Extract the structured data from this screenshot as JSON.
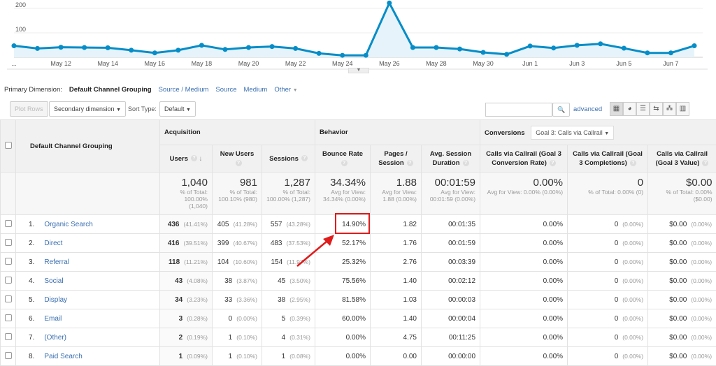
{
  "chart_data": {
    "type": "area",
    "x": [
      "May 10",
      "May 11",
      "May 12",
      "May 13",
      "May 14",
      "May 15",
      "May 16",
      "May 17",
      "May 18",
      "May 19",
      "May 20",
      "May 21",
      "May 22",
      "May 23",
      "May 24",
      "May 25",
      "May 26",
      "May 27",
      "May 28",
      "May 29",
      "May 30",
      "May 31",
      "Jun 1",
      "Jun 2",
      "Jun 3",
      "Jun 4",
      "Jun 5",
      "Jun 6",
      "Jun 7",
      "Jun 8"
    ],
    "values": [
      47,
      36,
      41,
      40,
      39,
      29,
      18,
      29,
      49,
      32,
      40,
      44,
      36,
      16,
      8,
      8,
      222,
      40,
      40,
      34,
      20,
      12,
      46,
      38,
      49,
      55,
      37,
      18,
      18,
      47
    ],
    "x_tick_labels": [
      "...",
      "May 12",
      "May 14",
      "May 16",
      "May 18",
      "May 20",
      "May 22",
      "May 24",
      "May 26",
      "May 28",
      "May 30",
      "Jun 1",
      "Jun 3",
      "Jun 5",
      "Jun 7"
    ],
    "y_tick_labels": [
      "100",
      "200"
    ],
    "ylim": [
      0,
      235
    ],
    "grid": true,
    "color": "#058dc7"
  },
  "primary_dimension": {
    "label": "Primary Dimension:",
    "active": "Default Channel Grouping",
    "options": [
      "Source / Medium",
      "Source",
      "Medium",
      "Other"
    ]
  },
  "toolbar": {
    "plot_rows": "Plot Rows",
    "secondary_dimension": "Secondary dimension",
    "sort_type_label": "Sort Type:",
    "sort_type": "Default",
    "search_placeholder": "",
    "advanced": "advanced"
  },
  "table": {
    "dimension_header": "Default Channel Grouping",
    "groups": {
      "acquisition": "Acquisition",
      "behavior": "Behavior",
      "conversions": "Conversions",
      "goal_select": "Goal 3: Calls via Callrail"
    },
    "columns": [
      "Users",
      "New Users",
      "Sessions",
      "Bounce Rate",
      "Pages / Session",
      "Avg. Session Duration",
      "Calls via Callrail (Goal 3 Conversion Rate)",
      "Calls via Callrail (Goal 3 Completions)",
      "Calls via Callrail (Goal 3 Value)"
    ],
    "totals": [
      {
        "value": "1,040",
        "sub": "% of Total: 100.00% (1,040)"
      },
      {
        "value": "981",
        "sub": "% of Total: 100.10% (980)"
      },
      {
        "value": "1,287",
        "sub": "% of Total: 100.00% (1,287)"
      },
      {
        "value": "34.34%",
        "sub": "Avg for View: 34.34% (0.00%)"
      },
      {
        "value": "1.88",
        "sub": "Avg for View: 1.88 (0.00%)"
      },
      {
        "value": "00:01:59",
        "sub": "Avg for View: 00:01:59 (0.00%)"
      },
      {
        "value": "0.00%",
        "sub": "Avg for View: 0.00% (0.00%)"
      },
      {
        "value": "0",
        "sub": "% of Total: 0.00% (0)"
      },
      {
        "value": "$0.00",
        "sub": "% of Total: 0.00% ($0.00)"
      }
    ],
    "rows": [
      {
        "n": "1.",
        "name": "Organic Search",
        "users": "436",
        "users_pc": "(41.41%)",
        "new": "405",
        "new_pc": "(41.28%)",
        "sess": "557",
        "sess_pc": "(43.28%)",
        "bounce": "14.90%",
        "pps": "1.82",
        "dur": "00:01:35",
        "cr": "0.00%",
        "comp": "0",
        "comp_pc": "(0.00%)",
        "val": "$0.00",
        "val_pc": "(0.00%)"
      },
      {
        "n": "2.",
        "name": "Direct",
        "users": "416",
        "users_pc": "(39.51%)",
        "new": "399",
        "new_pc": "(40.67%)",
        "sess": "483",
        "sess_pc": "(37.53%)",
        "bounce": "52.17%",
        "pps": "1.76",
        "dur": "00:01:59",
        "cr": "0.00%",
        "comp": "0",
        "comp_pc": "(0.00%)",
        "val": "$0.00",
        "val_pc": "(0.00%)"
      },
      {
        "n": "3.",
        "name": "Referral",
        "users": "118",
        "users_pc": "(11.21%)",
        "new": "104",
        "new_pc": "(10.60%)",
        "sess": "154",
        "sess_pc": "(11.97%)",
        "bounce": "25.32%",
        "pps": "2.76",
        "dur": "00:03:39",
        "cr": "0.00%",
        "comp": "0",
        "comp_pc": "(0.00%)",
        "val": "$0.00",
        "val_pc": "(0.00%)"
      },
      {
        "n": "4.",
        "name": "Social",
        "users": "43",
        "users_pc": "(4.08%)",
        "new": "38",
        "new_pc": "(3.87%)",
        "sess": "45",
        "sess_pc": "(3.50%)",
        "bounce": "75.56%",
        "pps": "1.40",
        "dur": "00:02:12",
        "cr": "0.00%",
        "comp": "0",
        "comp_pc": "(0.00%)",
        "val": "$0.00",
        "val_pc": "(0.00%)"
      },
      {
        "n": "5.",
        "name": "Display",
        "users": "34",
        "users_pc": "(3.23%)",
        "new": "33",
        "new_pc": "(3.36%)",
        "sess": "38",
        "sess_pc": "(2.95%)",
        "bounce": "81.58%",
        "pps": "1.03",
        "dur": "00:00:03",
        "cr": "0.00%",
        "comp": "0",
        "comp_pc": "(0.00%)",
        "val": "$0.00",
        "val_pc": "(0.00%)"
      },
      {
        "n": "6.",
        "name": "Email",
        "users": "3",
        "users_pc": "(0.28%)",
        "new": "0",
        "new_pc": "(0.00%)",
        "sess": "5",
        "sess_pc": "(0.39%)",
        "bounce": "60.00%",
        "pps": "1.40",
        "dur": "00:00:04",
        "cr": "0.00%",
        "comp": "0",
        "comp_pc": "(0.00%)",
        "val": "$0.00",
        "val_pc": "(0.00%)"
      },
      {
        "n": "7.",
        "name": "(Other)",
        "users": "2",
        "users_pc": "(0.19%)",
        "new": "1",
        "new_pc": "(0.10%)",
        "sess": "4",
        "sess_pc": "(0.31%)",
        "bounce": "0.00%",
        "pps": "4.75",
        "dur": "00:11:25",
        "cr": "0.00%",
        "comp": "0",
        "comp_pc": "(0.00%)",
        "val": "$0.00",
        "val_pc": "(0.00%)"
      },
      {
        "n": "8.",
        "name": "Paid Search",
        "users": "1",
        "users_pc": "(0.09%)",
        "new": "1",
        "new_pc": "(0.10%)",
        "sess": "1",
        "sess_pc": "(0.08%)",
        "bounce": "0.00%",
        "pps": "0.00",
        "dur": "00:00:00",
        "cr": "0.00%",
        "comp": "0",
        "comp_pc": "(0.00%)",
        "val": "$0.00",
        "val_pc": "(0.00%)"
      }
    ]
  },
  "annotation_color": "#e01b1b"
}
